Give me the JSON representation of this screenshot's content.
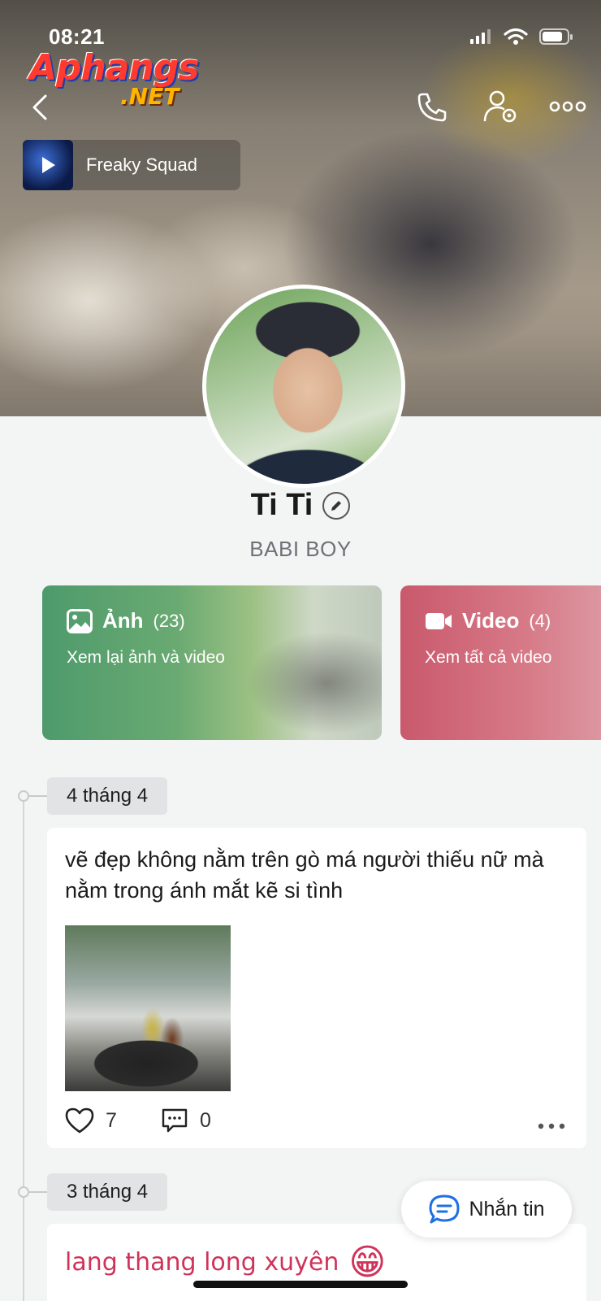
{
  "status_bar": {
    "time": "08:21"
  },
  "watermark": {
    "main": "Aphangs",
    "suffix": ".NET"
  },
  "header": {
    "icons": [
      "back-chevron-icon",
      "phone-icon",
      "profile-settings-icon",
      "more-horizontal-icon"
    ]
  },
  "music": {
    "title": "Freaky Squad"
  },
  "profile": {
    "name": "Ti Ti",
    "status": "BABI BOY"
  },
  "cards": {
    "photos": {
      "title": "Ảnh",
      "count": "(23)",
      "subtitle": "Xem lại ảnh và video"
    },
    "videos": {
      "title": "Video",
      "count": "(4)",
      "subtitle": "Xem tất cả video"
    }
  },
  "timeline": [
    {
      "date": "4 tháng 4",
      "text": "vẽ đẹp không nằm trên gò má người thiếu nữ mà nằm trong ánh mắt kẽ si tình",
      "likes": "7",
      "comments": "0"
    },
    {
      "date": "3 tháng 4",
      "text": "lang thang long xuyên",
      "emoji": "😁"
    }
  ],
  "message_button": {
    "label": "Nhắn tin"
  },
  "colors": {
    "accent_blue": "#1f6fe5",
    "photo_card": "#4e9a6c",
    "video_card": "#c9596c",
    "post2_text": "#d0335a"
  }
}
